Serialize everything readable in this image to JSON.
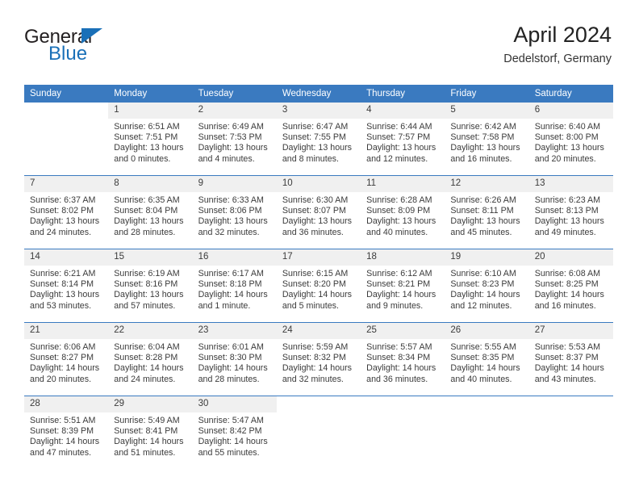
{
  "brand": {
    "name_part1": "General",
    "name_part2": "Blue",
    "triangle_icon": "blue-triangle-logo-mark"
  },
  "header": {
    "title": "April 2024",
    "subtitle": "Dedelstorf, Germany"
  },
  "colors": {
    "header_blue": "#3a7ac0",
    "brand_blue": "#1a70b8",
    "daynum_band": "#f0f0f0",
    "text": "#3b3b3b"
  },
  "weekday_headers": [
    "Sunday",
    "Monday",
    "Tuesday",
    "Wednesday",
    "Thursday",
    "Friday",
    "Saturday"
  ],
  "weeks": [
    [
      {
        "day": "",
        "lines": []
      },
      {
        "day": "1",
        "lines": [
          "Sunrise: 6:51 AM",
          "Sunset: 7:51 PM",
          "Daylight: 13 hours",
          "and 0 minutes."
        ]
      },
      {
        "day": "2",
        "lines": [
          "Sunrise: 6:49 AM",
          "Sunset: 7:53 PM",
          "Daylight: 13 hours",
          "and 4 minutes."
        ]
      },
      {
        "day": "3",
        "lines": [
          "Sunrise: 6:47 AM",
          "Sunset: 7:55 PM",
          "Daylight: 13 hours",
          "and 8 minutes."
        ]
      },
      {
        "day": "4",
        "lines": [
          "Sunrise: 6:44 AM",
          "Sunset: 7:57 PM",
          "Daylight: 13 hours",
          "and 12 minutes."
        ]
      },
      {
        "day": "5",
        "lines": [
          "Sunrise: 6:42 AM",
          "Sunset: 7:58 PM",
          "Daylight: 13 hours",
          "and 16 minutes."
        ]
      },
      {
        "day": "6",
        "lines": [
          "Sunrise: 6:40 AM",
          "Sunset: 8:00 PM",
          "Daylight: 13 hours",
          "and 20 minutes."
        ]
      }
    ],
    [
      {
        "day": "7",
        "lines": [
          "Sunrise: 6:37 AM",
          "Sunset: 8:02 PM",
          "Daylight: 13 hours",
          "and 24 minutes."
        ]
      },
      {
        "day": "8",
        "lines": [
          "Sunrise: 6:35 AM",
          "Sunset: 8:04 PM",
          "Daylight: 13 hours",
          "and 28 minutes."
        ]
      },
      {
        "day": "9",
        "lines": [
          "Sunrise: 6:33 AM",
          "Sunset: 8:06 PM",
          "Daylight: 13 hours",
          "and 32 minutes."
        ]
      },
      {
        "day": "10",
        "lines": [
          "Sunrise: 6:30 AM",
          "Sunset: 8:07 PM",
          "Daylight: 13 hours",
          "and 36 minutes."
        ]
      },
      {
        "day": "11",
        "lines": [
          "Sunrise: 6:28 AM",
          "Sunset: 8:09 PM",
          "Daylight: 13 hours",
          "and 40 minutes."
        ]
      },
      {
        "day": "12",
        "lines": [
          "Sunrise: 6:26 AM",
          "Sunset: 8:11 PM",
          "Daylight: 13 hours",
          "and 45 minutes."
        ]
      },
      {
        "day": "13",
        "lines": [
          "Sunrise: 6:23 AM",
          "Sunset: 8:13 PM",
          "Daylight: 13 hours",
          "and 49 minutes."
        ]
      }
    ],
    [
      {
        "day": "14",
        "lines": [
          "Sunrise: 6:21 AM",
          "Sunset: 8:14 PM",
          "Daylight: 13 hours",
          "and 53 minutes."
        ]
      },
      {
        "day": "15",
        "lines": [
          "Sunrise: 6:19 AM",
          "Sunset: 8:16 PM",
          "Daylight: 13 hours",
          "and 57 minutes."
        ]
      },
      {
        "day": "16",
        "lines": [
          "Sunrise: 6:17 AM",
          "Sunset: 8:18 PM",
          "Daylight: 14 hours",
          "and 1 minute."
        ]
      },
      {
        "day": "17",
        "lines": [
          "Sunrise: 6:15 AM",
          "Sunset: 8:20 PM",
          "Daylight: 14 hours",
          "and 5 minutes."
        ]
      },
      {
        "day": "18",
        "lines": [
          "Sunrise: 6:12 AM",
          "Sunset: 8:21 PM",
          "Daylight: 14 hours",
          "and 9 minutes."
        ]
      },
      {
        "day": "19",
        "lines": [
          "Sunrise: 6:10 AM",
          "Sunset: 8:23 PM",
          "Daylight: 14 hours",
          "and 12 minutes."
        ]
      },
      {
        "day": "20",
        "lines": [
          "Sunrise: 6:08 AM",
          "Sunset: 8:25 PM",
          "Daylight: 14 hours",
          "and 16 minutes."
        ]
      }
    ],
    [
      {
        "day": "21",
        "lines": [
          "Sunrise: 6:06 AM",
          "Sunset: 8:27 PM",
          "Daylight: 14 hours",
          "and 20 minutes."
        ]
      },
      {
        "day": "22",
        "lines": [
          "Sunrise: 6:04 AM",
          "Sunset: 8:28 PM",
          "Daylight: 14 hours",
          "and 24 minutes."
        ]
      },
      {
        "day": "23",
        "lines": [
          "Sunrise: 6:01 AM",
          "Sunset: 8:30 PM",
          "Daylight: 14 hours",
          "and 28 minutes."
        ]
      },
      {
        "day": "24",
        "lines": [
          "Sunrise: 5:59 AM",
          "Sunset: 8:32 PM",
          "Daylight: 14 hours",
          "and 32 minutes."
        ]
      },
      {
        "day": "25",
        "lines": [
          "Sunrise: 5:57 AM",
          "Sunset: 8:34 PM",
          "Daylight: 14 hours",
          "and 36 minutes."
        ]
      },
      {
        "day": "26",
        "lines": [
          "Sunrise: 5:55 AM",
          "Sunset: 8:35 PM",
          "Daylight: 14 hours",
          "and 40 minutes."
        ]
      },
      {
        "day": "27",
        "lines": [
          "Sunrise: 5:53 AM",
          "Sunset: 8:37 PM",
          "Daylight: 14 hours",
          "and 43 minutes."
        ]
      }
    ],
    [
      {
        "day": "28",
        "lines": [
          "Sunrise: 5:51 AM",
          "Sunset: 8:39 PM",
          "Daylight: 14 hours",
          "and 47 minutes."
        ]
      },
      {
        "day": "29",
        "lines": [
          "Sunrise: 5:49 AM",
          "Sunset: 8:41 PM",
          "Daylight: 14 hours",
          "and 51 minutes."
        ]
      },
      {
        "day": "30",
        "lines": [
          "Sunrise: 5:47 AM",
          "Sunset: 8:42 PM",
          "Daylight: 14 hours",
          "and 55 minutes."
        ]
      },
      {
        "day": "",
        "lines": []
      },
      {
        "day": "",
        "lines": []
      },
      {
        "day": "",
        "lines": []
      },
      {
        "day": "",
        "lines": []
      }
    ]
  ]
}
